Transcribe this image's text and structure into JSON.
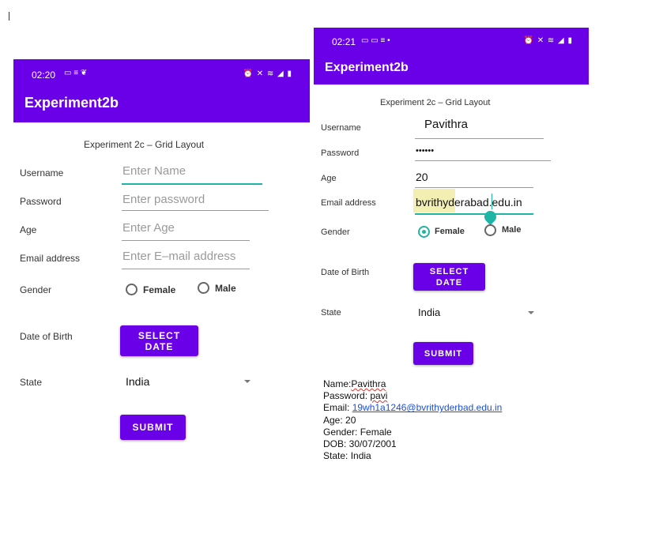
{
  "left_screen": {
    "status_time": "02:20",
    "app_title": "Experiment2b",
    "subtitle": "Experiment 2c – Grid Layout",
    "labels": {
      "username": "Username",
      "password": "Password",
      "age": "Age",
      "email": "Email address",
      "gender": "Gender",
      "dob": "Date of Birth",
      "state": "State"
    },
    "placeholders": {
      "username": "Enter Name",
      "password": "Enter password",
      "age": "Enter Age",
      "email": "Enter E–mail address"
    },
    "gender_options": [
      "Female",
      "Male"
    ],
    "select_date_line1": "SELECT",
    "select_date_line2": "DATE",
    "state_value": "India",
    "submit": "SUBMIT"
  },
  "right_screen": {
    "status_time": "02:21",
    "app_title": "Experiment2b",
    "subtitle": "Experiment 2c – Grid Layout",
    "labels": {
      "username": "Username",
      "password": "Password",
      "age": "Age",
      "email": "Email address",
      "gender": "Gender",
      "dob": "Date of Birth",
      "state": "State"
    },
    "values": {
      "username": "Pavithra",
      "password": "••••••",
      "age": "20",
      "email": "bvrithyderabad.edu.in"
    },
    "gender_options": [
      "Female",
      "Male"
    ],
    "gender_selected": "Female",
    "select_date_line1": "SELECT",
    "select_date_line2": "DATE",
    "state_value": "India",
    "submit": "SUBMIT"
  },
  "output": {
    "name_label": "Name:",
    "name_value": "Pavithra",
    "password_label": "Password: ",
    "password_value": "pavi",
    "email_label": "Email: ",
    "email_value": "19wh1a1246@bvrithyderbad.edu.in",
    "age_line": "Age: 20",
    "gender_line": "Gender: Female",
    "dob_line": "DOB: 30/07/2001",
    "state_line": "State: India"
  },
  "colors": {
    "primary": "#6a00e8",
    "accent": "#1fb5a5",
    "link": "#1f4fd8"
  }
}
